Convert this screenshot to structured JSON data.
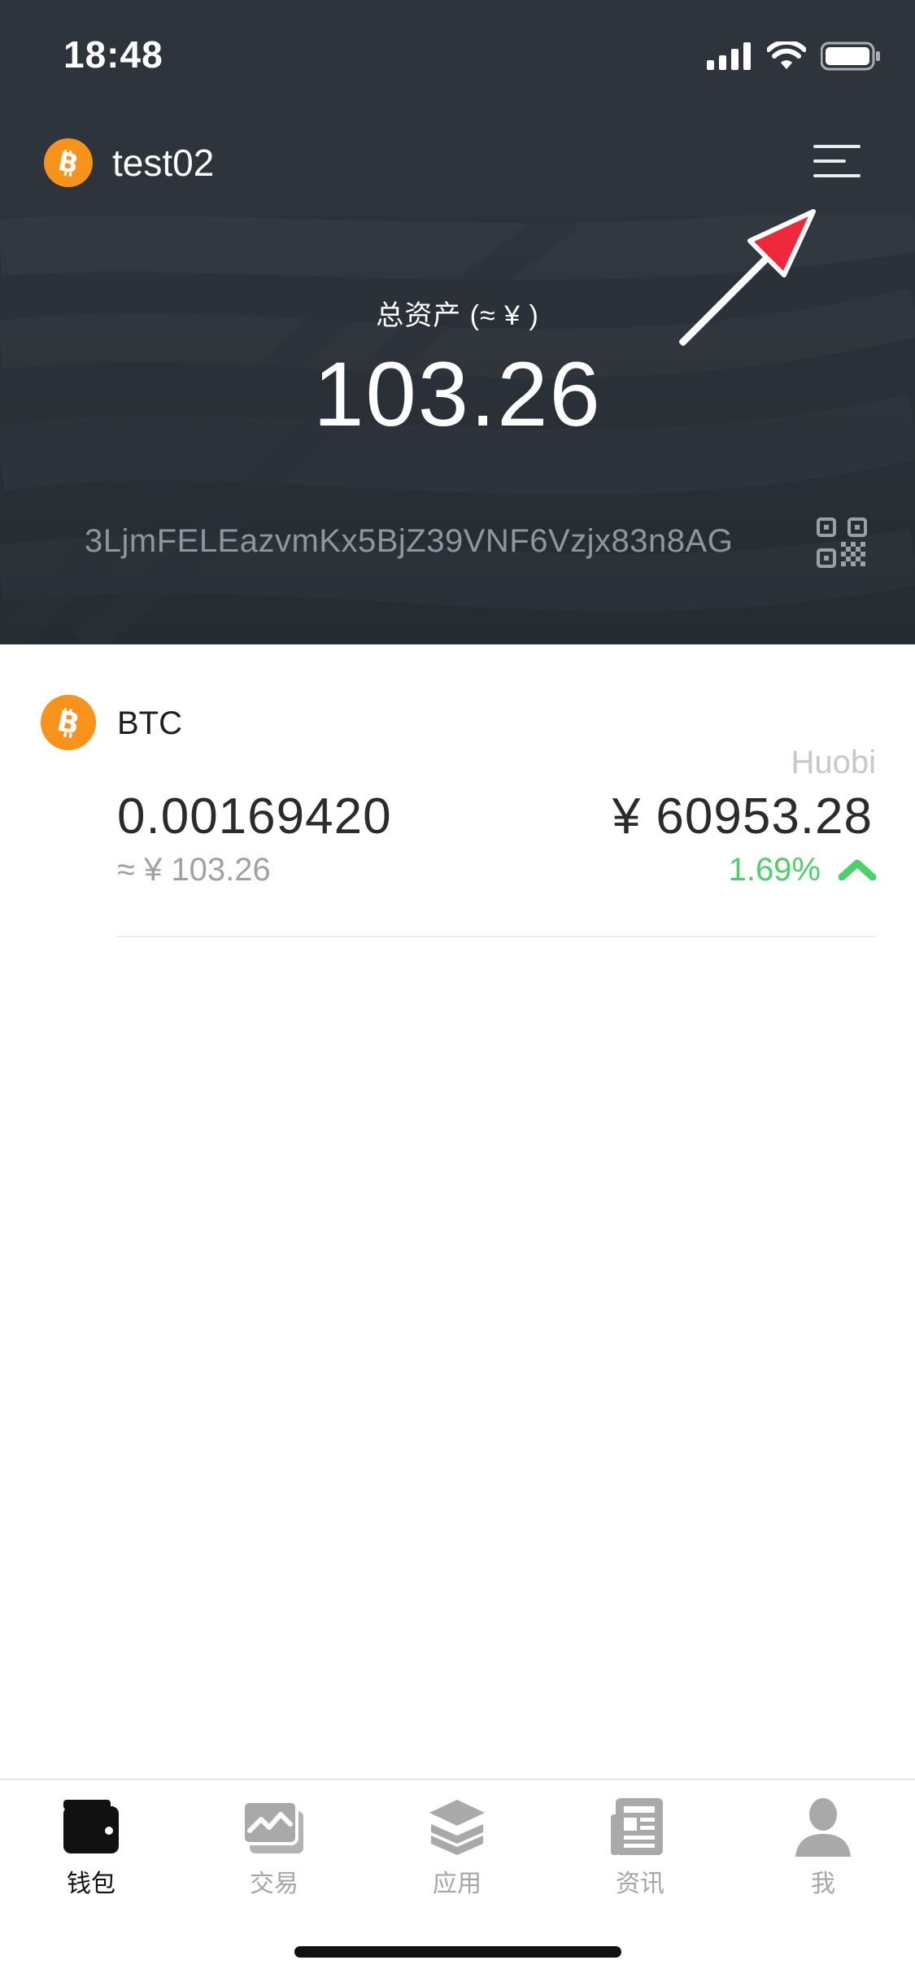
{
  "status_bar": {
    "time": "18:48",
    "icons": [
      "cellular-signal-icon",
      "wifi-icon",
      "battery-icon"
    ]
  },
  "header": {
    "wallet_name": "test02",
    "wallet_icon": "bitcoin-icon",
    "menu_icon": "hamburger-menu-icon"
  },
  "summary": {
    "total_label": "总资产 (≈ ¥ )",
    "total_value": "103.26",
    "address": "3LjmFELEazvmKx5BjZ39VNF6Vzjx83n8AG",
    "qr_icon": "qr-code-icon"
  },
  "assets": [
    {
      "symbol": "BTC",
      "icon": "bitcoin-icon",
      "balance": "0.00169420",
      "balance_cny": "≈ ¥ 103.26",
      "price_source": "Huobi",
      "price": "¥ 60953.28",
      "change": "1.69%",
      "trend": "up"
    }
  ],
  "tabbar": {
    "tabs": [
      {
        "label": "钱包",
        "icon": "wallet-icon",
        "active": true
      },
      {
        "label": "交易",
        "icon": "trade-chart-icon",
        "active": false
      },
      {
        "label": "应用",
        "icon": "layers-icon",
        "active": false
      },
      {
        "label": "资讯",
        "icon": "news-icon",
        "active": false
      },
      {
        "label": "我",
        "icon": "user-icon",
        "active": false
      }
    ]
  },
  "colors": {
    "header_bg": "#2d343c",
    "bitcoin_orange": "#f7931a",
    "up_green": "#4cd06a",
    "annotation_red": "#f0283c"
  }
}
